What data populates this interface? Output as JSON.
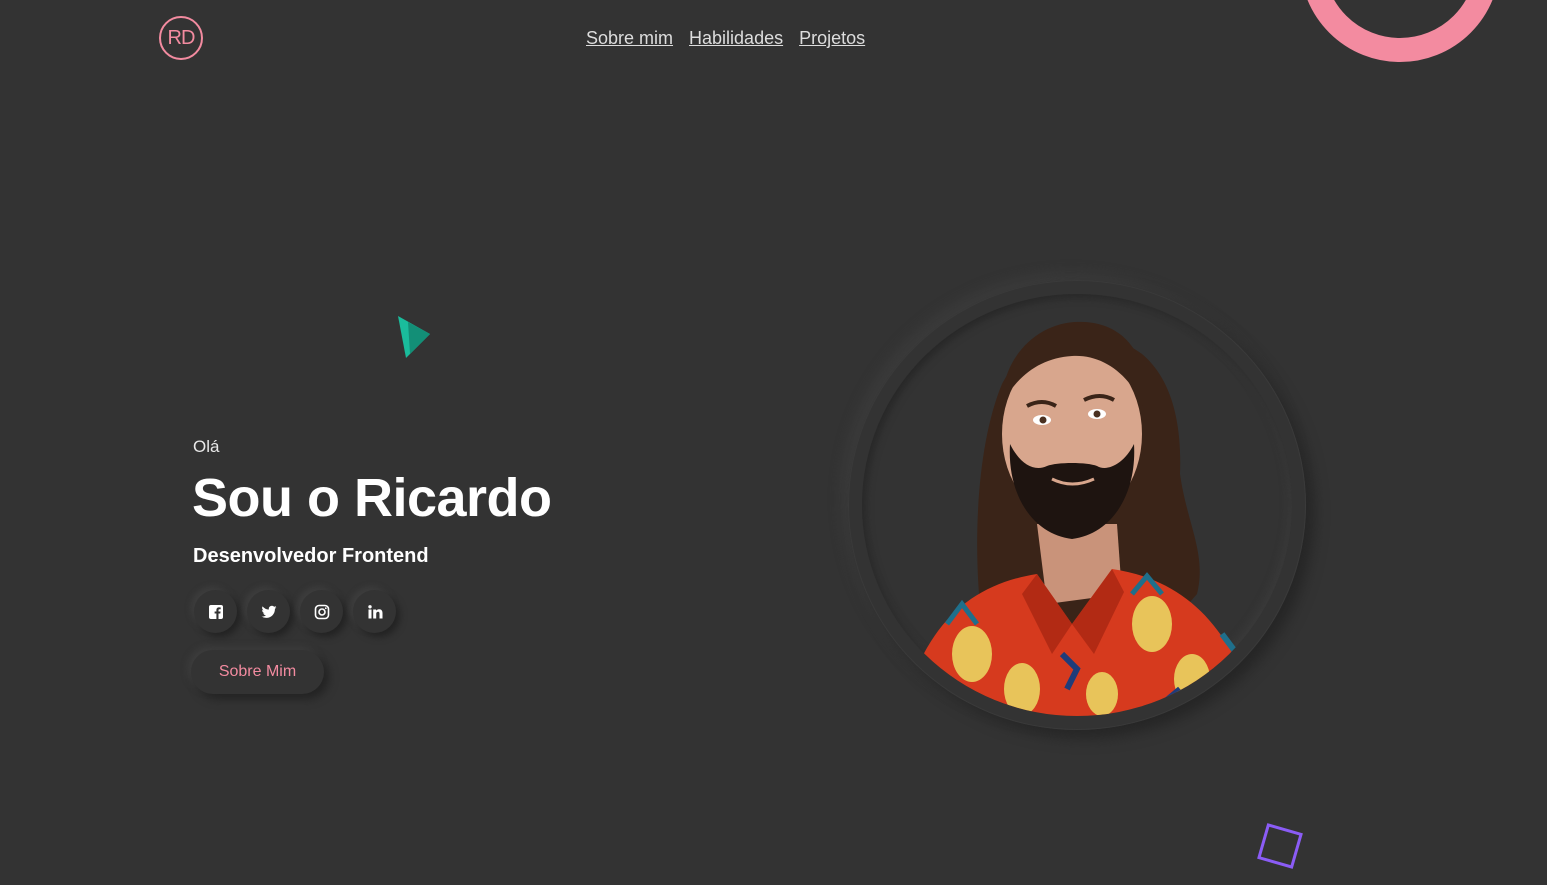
{
  "header": {
    "logo_text": "RD",
    "nav": [
      {
        "label": "Sobre mim"
      },
      {
        "label": "Habilidades"
      },
      {
        "label": "Projetos"
      }
    ]
  },
  "hero": {
    "greeting": "Olá",
    "title": "Sou o Ricardo",
    "subtitle": "Desenvolvedor Frontend",
    "cta_label": "Sobre Mim",
    "socials": [
      {
        "icon": "facebook-icon"
      },
      {
        "icon": "twitter-icon"
      },
      {
        "icon": "instagram-icon"
      },
      {
        "icon": "linkedin-icon"
      }
    ]
  },
  "colors": {
    "background": "#333333",
    "accent_pink": "#f38ba0",
    "accent_teal": "#1abc9c",
    "accent_purple": "#8b5cf6"
  }
}
